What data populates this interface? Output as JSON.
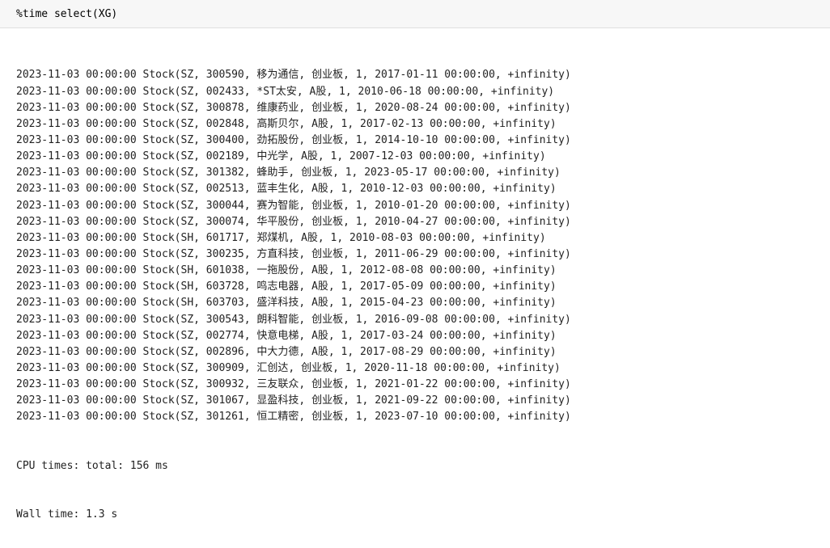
{
  "input": {
    "code": "%time select(XG)"
  },
  "output": {
    "rows": [
      {
        "date": "2023-11-03 00:00:00",
        "market": "SZ",
        "code": "300590",
        "name": "移为通信",
        "board": "创业板",
        "flag": "1",
        "list_date": "2017-01-11 00:00:00",
        "end": "+infinity"
      },
      {
        "date": "2023-11-03 00:00:00",
        "market": "SZ",
        "code": "002433",
        "name": "*ST太安",
        "board": "A股",
        "flag": "1",
        "list_date": "2010-06-18 00:00:00",
        "end": "+infinity"
      },
      {
        "date": "2023-11-03 00:00:00",
        "market": "SZ",
        "code": "300878",
        "name": "维康药业",
        "board": "创业板",
        "flag": "1",
        "list_date": "2020-08-24 00:00:00",
        "end": "+infinity"
      },
      {
        "date": "2023-11-03 00:00:00",
        "market": "SZ",
        "code": "002848",
        "name": "高斯贝尔",
        "board": "A股",
        "flag": "1",
        "list_date": "2017-02-13 00:00:00",
        "end": "+infinity"
      },
      {
        "date": "2023-11-03 00:00:00",
        "market": "SZ",
        "code": "300400",
        "name": "劲拓股份",
        "board": "创业板",
        "flag": "1",
        "list_date": "2014-10-10 00:00:00",
        "end": "+infinity"
      },
      {
        "date": "2023-11-03 00:00:00",
        "market": "SZ",
        "code": "002189",
        "name": "中光学",
        "board": "A股",
        "flag": "1",
        "list_date": "2007-12-03 00:00:00",
        "end": "+infinity"
      },
      {
        "date": "2023-11-03 00:00:00",
        "market": "SZ",
        "code": "301382",
        "name": "蜂助手",
        "board": "创业板",
        "flag": "1",
        "list_date": "2023-05-17 00:00:00",
        "end": "+infinity"
      },
      {
        "date": "2023-11-03 00:00:00",
        "market": "SZ",
        "code": "002513",
        "name": "蓝丰生化",
        "board": "A股",
        "flag": "1",
        "list_date": "2010-12-03 00:00:00",
        "end": "+infinity"
      },
      {
        "date": "2023-11-03 00:00:00",
        "market": "SZ",
        "code": "300044",
        "name": "赛为智能",
        "board": "创业板",
        "flag": "1",
        "list_date": "2010-01-20 00:00:00",
        "end": "+infinity"
      },
      {
        "date": "2023-11-03 00:00:00",
        "market": "SZ",
        "code": "300074",
        "name": "华平股份",
        "board": "创业板",
        "flag": "1",
        "list_date": "2010-04-27 00:00:00",
        "end": "+infinity"
      },
      {
        "date": "2023-11-03 00:00:00",
        "market": "SH",
        "code": "601717",
        "name": "郑煤机",
        "board": "A股",
        "flag": "1",
        "list_date": "2010-08-03 00:00:00",
        "end": "+infinity"
      },
      {
        "date": "2023-11-03 00:00:00",
        "market": "SZ",
        "code": "300235",
        "name": "方直科技",
        "board": "创业板",
        "flag": "1",
        "list_date": "2011-06-29 00:00:00",
        "end": "+infinity"
      },
      {
        "date": "2023-11-03 00:00:00",
        "market": "SH",
        "code": "601038",
        "name": "一拖股份",
        "board": "A股",
        "flag": "1",
        "list_date": "2012-08-08 00:00:00",
        "end": "+infinity"
      },
      {
        "date": "2023-11-03 00:00:00",
        "market": "SH",
        "code": "603728",
        "name": "鸣志电器",
        "board": "A股",
        "flag": "1",
        "list_date": "2017-05-09 00:00:00",
        "end": "+infinity"
      },
      {
        "date": "2023-11-03 00:00:00",
        "market": "SH",
        "code": "603703",
        "name": "盛洋科技",
        "board": "A股",
        "flag": "1",
        "list_date": "2015-04-23 00:00:00",
        "end": "+infinity"
      },
      {
        "date": "2023-11-03 00:00:00",
        "market": "SZ",
        "code": "300543",
        "name": "朗科智能",
        "board": "创业板",
        "flag": "1",
        "list_date": "2016-09-08 00:00:00",
        "end": "+infinity"
      },
      {
        "date": "2023-11-03 00:00:00",
        "market": "SZ",
        "code": "002774",
        "name": "快意电梯",
        "board": "A股",
        "flag": "1",
        "list_date": "2017-03-24 00:00:00",
        "end": "+infinity"
      },
      {
        "date": "2023-11-03 00:00:00",
        "market": "SZ",
        "code": "002896",
        "name": "中大力德",
        "board": "A股",
        "flag": "1",
        "list_date": "2017-08-29 00:00:00",
        "end": "+infinity"
      },
      {
        "date": "2023-11-03 00:00:00",
        "market": "SZ",
        "code": "300909",
        "name": "汇创达",
        "board": "创业板",
        "flag": "1",
        "list_date": "2020-11-18 00:00:00",
        "end": "+infinity"
      },
      {
        "date": "2023-11-03 00:00:00",
        "market": "SZ",
        "code": "300932",
        "name": "三友联众",
        "board": "创业板",
        "flag": "1",
        "list_date": "2021-01-22 00:00:00",
        "end": "+infinity"
      },
      {
        "date": "2023-11-03 00:00:00",
        "market": "SZ",
        "code": "301067",
        "name": "显盈科技",
        "board": "创业板",
        "flag": "1",
        "list_date": "2021-09-22 00:00:00",
        "end": "+infinity"
      },
      {
        "date": "2023-11-03 00:00:00",
        "market": "SZ",
        "code": "301261",
        "name": "恒工精密",
        "board": "创业板",
        "flag": "1",
        "list_date": "2023-07-10 00:00:00",
        "end": "+infinity"
      }
    ],
    "timing": {
      "cpu_label": "CPU times: total: 156 ms",
      "wall_label": "Wall time: 1.3 s"
    }
  }
}
